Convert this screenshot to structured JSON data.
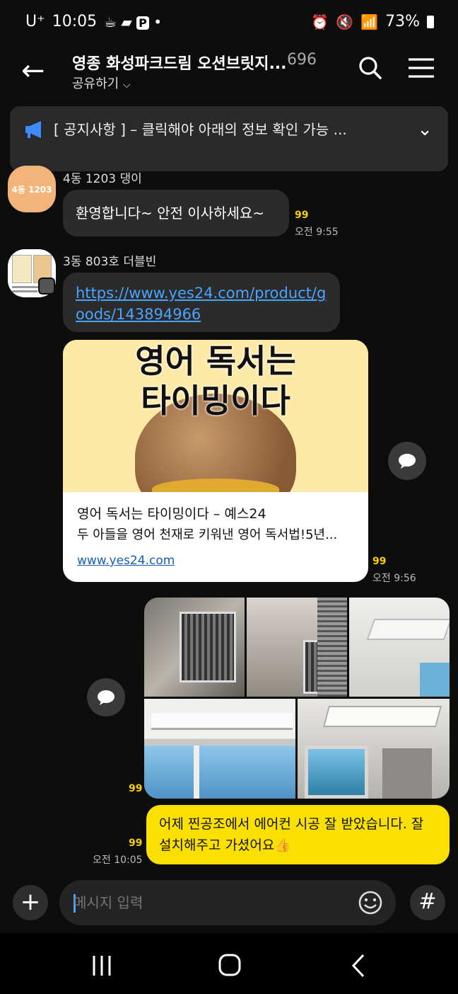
{
  "status": {
    "carrier": "U⁺",
    "time": "10:05",
    "battery": "73%"
  },
  "header": {
    "title": "영종 화성파크드림 오션브릿지...",
    "count": "696",
    "share": "공유하기"
  },
  "notice": {
    "text": "[ 공지사항 ] – 클릭해야 아래의 정보 확인 가능 ..."
  },
  "messages": [
    {
      "sender": "4동 1203 댕이",
      "avatar_text": "4동 1203",
      "text": "환영합니다~ 안전 이사하세요~",
      "unread": "99",
      "time": "오전 9:55"
    },
    {
      "sender": "3동 803호 더블빈",
      "link": "https://www.yes24.com/product/goods/143894966",
      "unread": "99",
      "time": "오전 9:56"
    }
  ],
  "card": {
    "image_text_line1": "영어 독서는",
    "image_text_line2": "타이밍이다",
    "title": "영어 독서는 타이밍이다 – 예스24",
    "desc": "두 아들을 영어 천재로 키워낸 영어 독서법!5년...",
    "url": "www.yes24.com"
  },
  "my_photos": {
    "unread": "99"
  },
  "my_message": {
    "text": "어제 찐공조에서 에어컨 시공 잘 받았습니다. 잘 설치해주고 가셨어요👍",
    "unread": "99",
    "time": "오전 10:05"
  },
  "input": {
    "placeholder": "메시지 입력"
  },
  "colors": {
    "accent": "#f9e000",
    "link": "#4aa3ff",
    "background": "#0d0d0d"
  }
}
